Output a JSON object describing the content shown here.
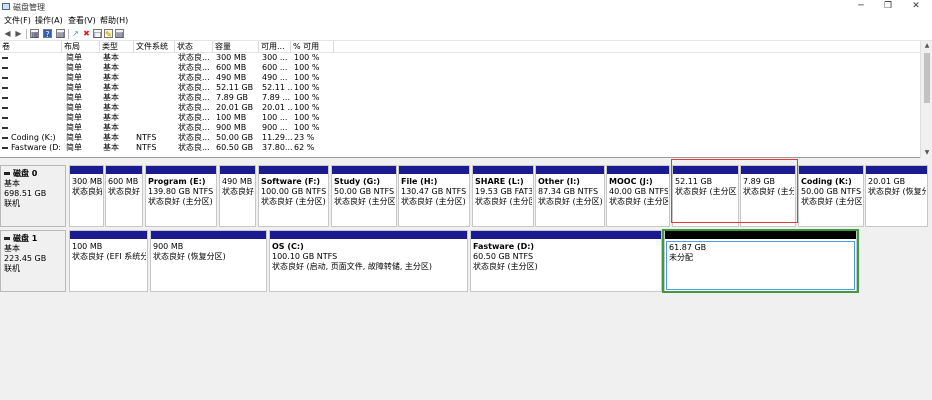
{
  "window": {
    "title": "磁盘管理",
    "minimize": "─",
    "maximize": "❐",
    "close": "✕"
  },
  "menu": [
    "文件(F)",
    "操作(A)",
    "查看(V)",
    "帮助(H)"
  ],
  "toolbar": {
    "icons": [
      "back-arrow-icon",
      "forward-arrow-icon",
      "properties-icon",
      "help-icon",
      "disk-list-icon",
      "connect-icon",
      "delete-icon",
      "open-icon",
      "explore-icon",
      "settings-icon"
    ],
    "glyphs": [
      "◀",
      "▶",
      "▦",
      "?",
      "▤",
      "↗",
      "✖",
      "□",
      "✎",
      "▤"
    ]
  },
  "volume_table": {
    "headers": [
      "卷",
      "布局",
      "类型",
      "文件系统",
      "状态",
      "容量",
      "可用...",
      "% 可用"
    ],
    "rows": [
      [
        "",
        "简单",
        "基本",
        "",
        "状态良...",
        "300 MB",
        "300 ...",
        "100 %"
      ],
      [
        "",
        "简单",
        "基本",
        "",
        "状态良...",
        "600 MB",
        "600 ...",
        "100 %"
      ],
      [
        "",
        "简单",
        "基本",
        "",
        "状态良...",
        "490 MB",
        "490 ...",
        "100 %"
      ],
      [
        "",
        "简单",
        "基本",
        "",
        "状态良...",
        "52.11 GB",
        "52.11 ...",
        "100 %"
      ],
      [
        "",
        "简单",
        "基本",
        "",
        "状态良...",
        "7.89 GB",
        "7.89 ...",
        "100 %"
      ],
      [
        "",
        "简单",
        "基本",
        "",
        "状态良...",
        "20.01 GB",
        "20.01 ...",
        "100 %"
      ],
      [
        "",
        "简单",
        "基本",
        "",
        "状态良...",
        "100 MB",
        "100 ...",
        "100 %"
      ],
      [
        "",
        "简单",
        "基本",
        "",
        "状态良...",
        "900 MB",
        "900 ...",
        "100 %"
      ],
      [
        "Coding (K:)",
        "简单",
        "基本",
        "NTFS",
        "状态良...",
        "50.00 GB",
        "11.29...",
        "23 %"
      ],
      [
        "Fastware (D:)",
        "简单",
        "基本",
        "NTFS",
        "状态良...",
        "60.50 GB",
        "37.80...",
        "62 %"
      ]
    ]
  },
  "disk0": {
    "name": "磁盘 0",
    "type": "基本",
    "size": "698.51 GB",
    "status": "联机",
    "partitions": [
      {
        "name": "",
        "size": "300 MB",
        "status": "状态良好"
      },
      {
        "name": "",
        "size": "600 MB",
        "status": "状态良好 ("
      },
      {
        "name": "Program  (E:)",
        "size": "139.80 GB NTFS",
        "status": "状态良好 (主分区)"
      },
      {
        "name": "",
        "size": "490 MB",
        "status": "状态良好"
      },
      {
        "name": "Software  (F:)",
        "size": "100.00 GB NTFS",
        "status": "状态良好 (主分区)"
      },
      {
        "name": "Study  (G:)",
        "size": "50.00 GB NTFS",
        "status": "状态良好 (主分区)"
      },
      {
        "name": "File  (H:)",
        "size": "130.47 GB NTFS",
        "status": "状态良好 (主分区)"
      },
      {
        "name": "SHARE  (L:)",
        "size": "19.53 GB FAT32",
        "status": "状态良好 (主分区)"
      },
      {
        "name": "Other  (I:)",
        "size": "87.34 GB NTFS",
        "status": "状态良好 (主分区)"
      },
      {
        "name": "MOOC  (J:)",
        "size": "40.00 GB NTFS",
        "status": "状态良好 (主分区)"
      },
      {
        "name": "",
        "size": "52.11 GB",
        "status": "状态良好 (主分区)"
      },
      {
        "name": "",
        "size": "7.89 GB",
        "status": "状态良好 (主分"
      },
      {
        "name": "Coding  (K:)",
        "size": "50.00 GB NTFS",
        "status": "状态良好 (主分区)"
      },
      {
        "name": "",
        "size": "20.01 GB",
        "status": "状态良好 (恢复分"
      }
    ]
  },
  "disk1": {
    "name": "磁盘 1",
    "type": "基本",
    "size": "223.45 GB",
    "status": "联机",
    "partitions": [
      {
        "name": "",
        "size": "100 MB",
        "status": "状态良好 (EFI 系统分区)"
      },
      {
        "name": "",
        "size": "900 MB",
        "status": "状态良好 (恢复分区)"
      },
      {
        "name": "OS  (C:)",
        "size": "100.10 GB NTFS",
        "status": "状态良好 (启动, 页面文件, 故障转储, 主分区)"
      },
      {
        "name": "Fastware  (D:)",
        "size": "60.50 GB NTFS",
        "status": "状态良好 (主分区)"
      },
      {
        "name": "",
        "size": "61.87 GB",
        "status": "未分配"
      }
    ]
  },
  "colors": {
    "primary_bar": "#1b1b8f",
    "unallocated_bar": "#000000",
    "highlight_red": "#e23b3b",
    "highlight_green": "#3e9a3e",
    "selection_blue": "#4d9be6"
  }
}
